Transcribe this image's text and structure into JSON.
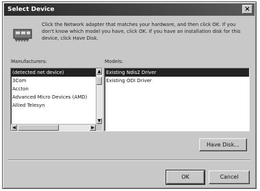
{
  "window": {
    "title": "Select Device",
    "close_glyph": "×"
  },
  "description": "Click the Network adapter that matches your hardware, and then click OK. If you don't know which model you have, click OK. If you have an installation disk for this device, click Have Disk.",
  "manufacturers": {
    "label": "Manufacturers:",
    "items": [
      {
        "label": "(detected net device)",
        "selected": true
      },
      {
        "label": "3Com",
        "selected": false
      },
      {
        "label": "Accton",
        "selected": false
      },
      {
        "label": "Advanced Micro Devices (AMD)",
        "selected": false
      },
      {
        "label": "Allied Telesyn",
        "selected": false
      }
    ]
  },
  "models": {
    "label": "Models:",
    "items": [
      {
        "label": "Existing Ndis2 Driver",
        "selected": true
      },
      {
        "label": "Existing ODI Driver",
        "selected": false
      }
    ]
  },
  "buttons": {
    "have_disk": "Have Disk...",
    "ok": "OK",
    "cancel": "Cancel"
  },
  "icons": {
    "device": "network-adapter-icon"
  }
}
